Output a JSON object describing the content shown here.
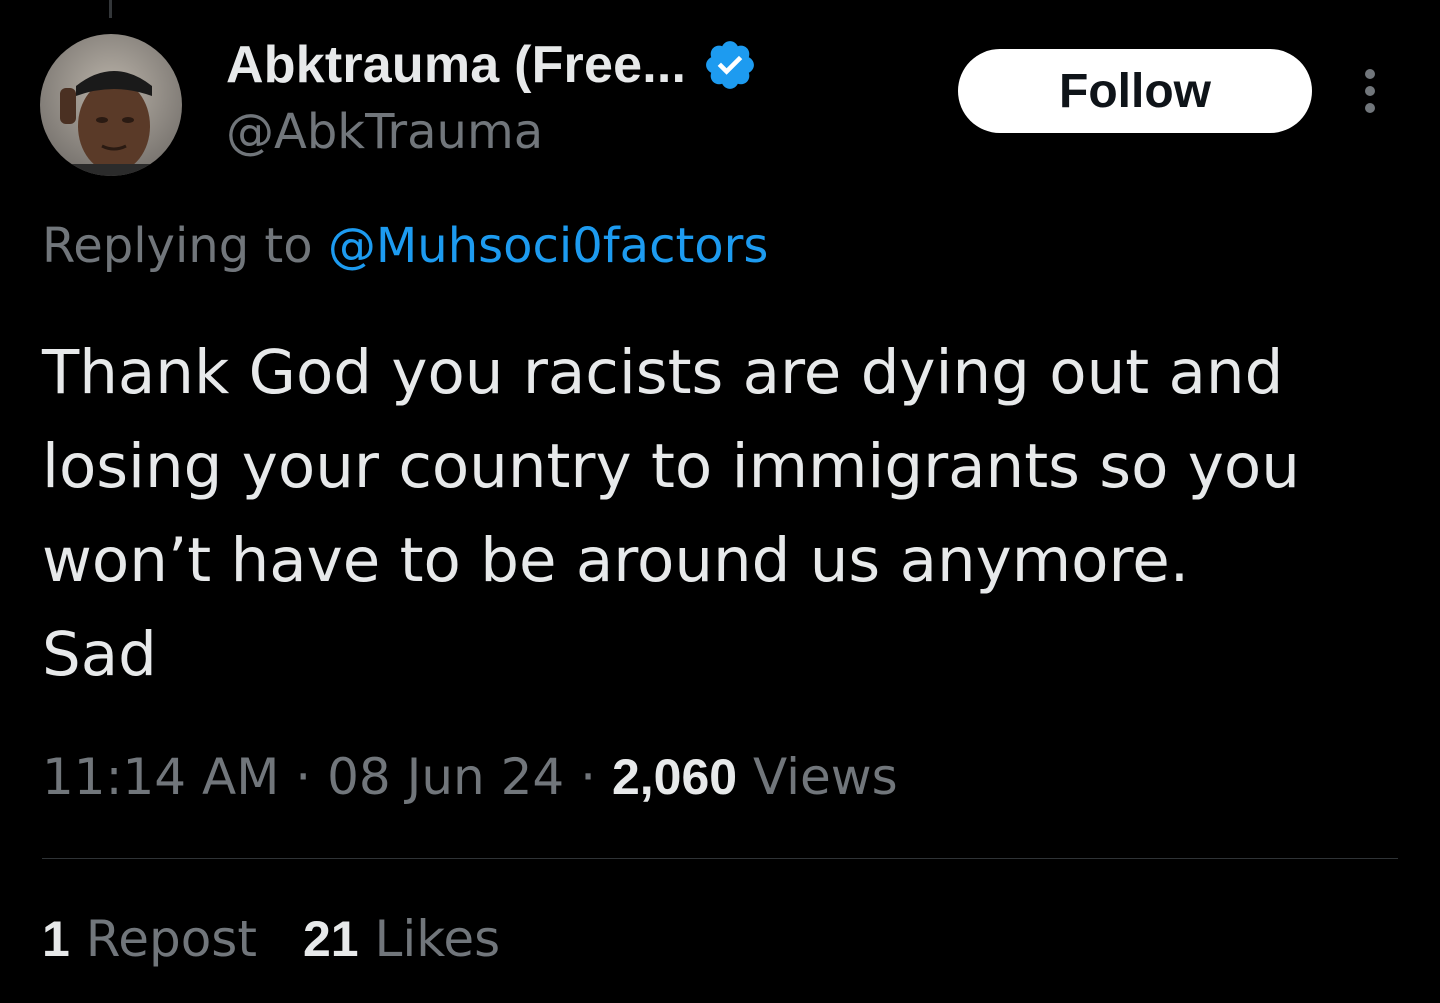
{
  "author": {
    "display_name": "Abktrauma (Free...",
    "handle": "@AbkTrauma",
    "verified_icon": "verified-badge-icon",
    "accent_color": "#1d9bf0"
  },
  "follow_label": "Follow",
  "more_icon": "more-options-icon",
  "reply_context": {
    "prefix": "Replying to",
    "mention": "@Muhsoci0factors"
  },
  "tweet": {
    "lines": [
      "Thank God you racists are dying out and",
      "losing your country to immigrants so you",
      "won’t have to be around us anymore.",
      "Sad"
    ]
  },
  "meta": {
    "time": "11:14 AM",
    "separator": "·",
    "date": "08 Jun 24",
    "views_count": "2,060",
    "views_label": "Views"
  },
  "stats": {
    "reposts_count": "1",
    "reposts_label": "Repost",
    "likes_count": "21",
    "likes_label": "Likes"
  },
  "colors": {
    "background": "#000000",
    "primary_text": "#e7e9ea",
    "secondary_text": "#71767b",
    "link": "#1d9bf0",
    "divider": "#2f3336"
  }
}
